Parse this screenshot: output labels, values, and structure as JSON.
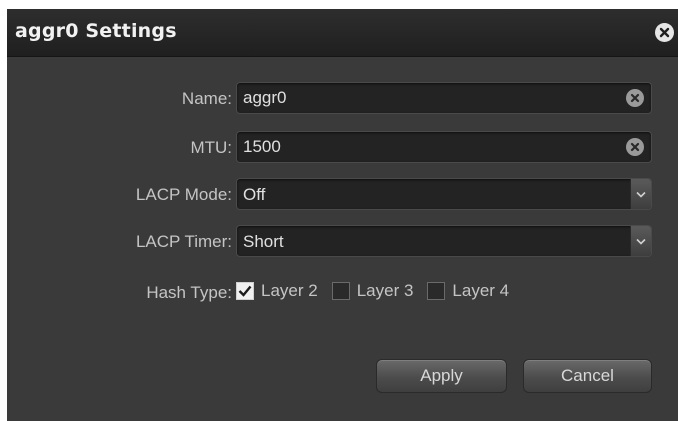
{
  "dialog": {
    "title": "aggr0 Settings"
  },
  "fields": {
    "name": {
      "label": "Name:",
      "value": "aggr0"
    },
    "mtu": {
      "label": "MTU:",
      "value": "1500"
    },
    "lacp_mode": {
      "label": "LACP Mode:",
      "value": "Off"
    },
    "lacp_timer": {
      "label": "LACP Timer:",
      "value": "Short"
    }
  },
  "hash_type": {
    "label": "Hash Type:",
    "options": [
      {
        "label": "Layer 2",
        "checked": true
      },
      {
        "label": "Layer 3",
        "checked": false
      },
      {
        "label": "Layer 4",
        "checked": false
      }
    ]
  },
  "buttons": {
    "apply": "Apply",
    "cancel": "Cancel"
  },
  "icons": {
    "close": "close-icon",
    "clear": "clear-icon",
    "dropdown": "chevron-down-icon",
    "check": "checkmark-icon"
  },
  "colors": {
    "dialog_bg": "#3a3a3a",
    "titlebar_bg": "#1f1f1f",
    "field_bg": "#232323",
    "text": "#c4c4c4"
  }
}
